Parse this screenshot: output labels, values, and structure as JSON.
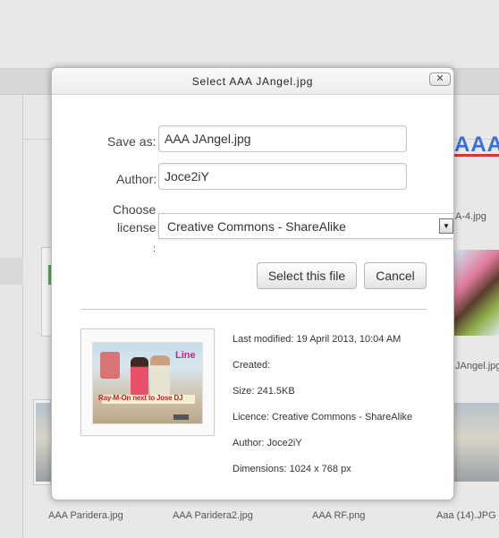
{
  "background": {
    "tile_labels": [
      "AAA Paridera.jpg",
      "AAA Paridera2.jpg",
      "AAA RF.png",
      "Aaa (14).JPG"
    ],
    "side_labels": [
      "A-4.jpg",
      "JAngel.jpg"
    ],
    "logo_text": "AAA"
  },
  "dialog": {
    "title": "Select AAA JAngel.jpg",
    "close_glyph": "✕",
    "fields": {
      "save_as_label": "Save as:",
      "save_as_value": "AAA JAngel.jpg",
      "author_label": "Author:",
      "author_value": "Joce2iY",
      "license_label_line1": "Choose",
      "license_label_line2": "license",
      "license_label_line3": ":",
      "license_selected": "Creative Commons - ShareAlike",
      "select_arrow_glyph": "▼"
    },
    "buttons": {
      "select_label": "Select this file",
      "cancel_label": "Cancel"
    },
    "thumbnail": {
      "caption": "Ray-M-On next to Jose DJ",
      "corner_text": "Line"
    },
    "details": {
      "last_modified": "Last modified: 19 April 2013, 10:04 AM",
      "created": "Created:",
      "size": "Size: 241.5KB",
      "licence": "Licence: Creative Commons - ShareAlike",
      "author": "Author: Joce2iY",
      "dimensions": "Dimensions: 1024 x 768 px"
    }
  },
  "colors": {
    "accent_logo": "#3a6fd8",
    "page_bg": "#e9e9e9"
  }
}
